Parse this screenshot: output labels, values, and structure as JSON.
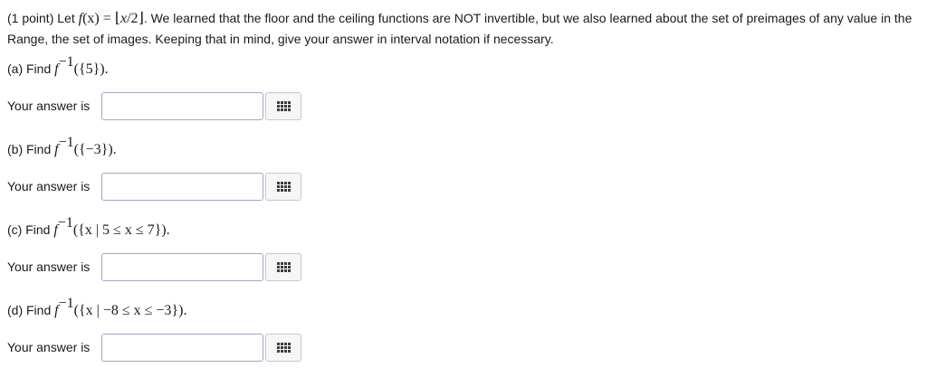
{
  "intro": {
    "point": "(1 point) Let ",
    "func": "f",
    "x_open": "(x) = ",
    "floor_open": "⌊",
    "floor_arg": "x",
    "floor_div": "/2",
    "floor_close": "⌋",
    "text1": ". We learned that the floor and the ceiling functions are NOT invertible, but we also learned about the set of preimages of any value in the Range, the set of images. Keeping that in mind, give your answer in interval notation if necessary."
  },
  "answer_label": "Your answer is",
  "parts": [
    {
      "label": "(a) Find ",
      "set": "({5})."
    },
    {
      "label": "(b) Find ",
      "set": "({−3})."
    },
    {
      "label": "(c) Find ",
      "set": "({x | 5 ≤ x ≤ 7})."
    },
    {
      "label": "(d) Find ",
      "set": "({x | −8 ≤ x ≤ −3})."
    }
  ],
  "inverse": {
    "func": "f",
    "exp": "−1"
  },
  "inputs": [
    "",
    "",
    "",
    ""
  ],
  "icons": {
    "palette": "grid-icon"
  },
  "colors": {
    "input_border": "#a9a2c9",
    "button_bg": "#f6f6f6"
  }
}
